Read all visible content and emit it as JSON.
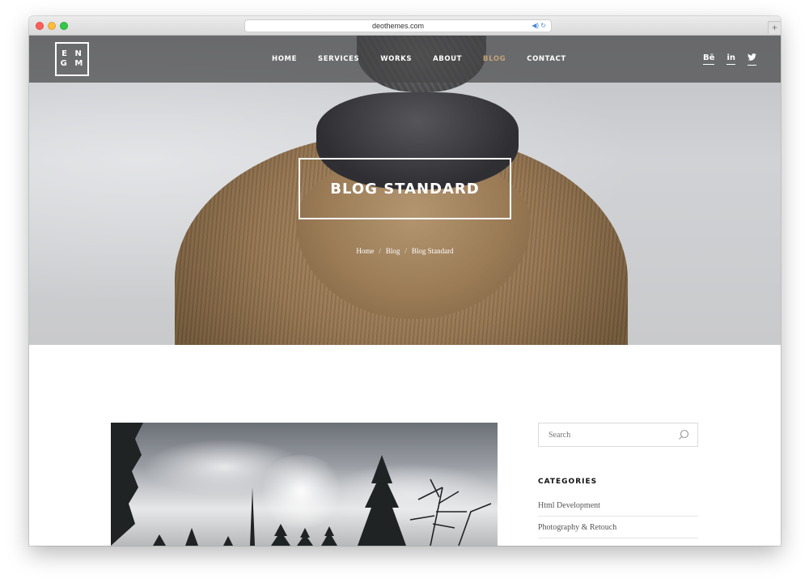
{
  "browser": {
    "url": "deothemes.com",
    "new_tab_label": "+"
  },
  "header": {
    "logo_line1": "E N",
    "logo_line2": "G M",
    "nav": [
      {
        "label": "HOME",
        "active": false
      },
      {
        "label": "SERVICES",
        "active": false
      },
      {
        "label": "WORKS",
        "active": false
      },
      {
        "label": "ABOUT",
        "active": false
      },
      {
        "label": "BLOG",
        "active": true
      },
      {
        "label": "CONTACT",
        "active": false
      }
    ],
    "social": [
      "Bē",
      "in",
      "🐦"
    ],
    "active_color": "#c4a47a"
  },
  "hero": {
    "title": "BLOG STANDARD",
    "breadcrumb": [
      "Home",
      "Blog",
      "Blog Standard"
    ],
    "breadcrumb_separator": "/"
  },
  "sidebar": {
    "search_placeholder": "Search",
    "categories_title": "CATEGORIES",
    "categories": [
      "Html Development",
      "Photography & Retouch"
    ]
  }
}
